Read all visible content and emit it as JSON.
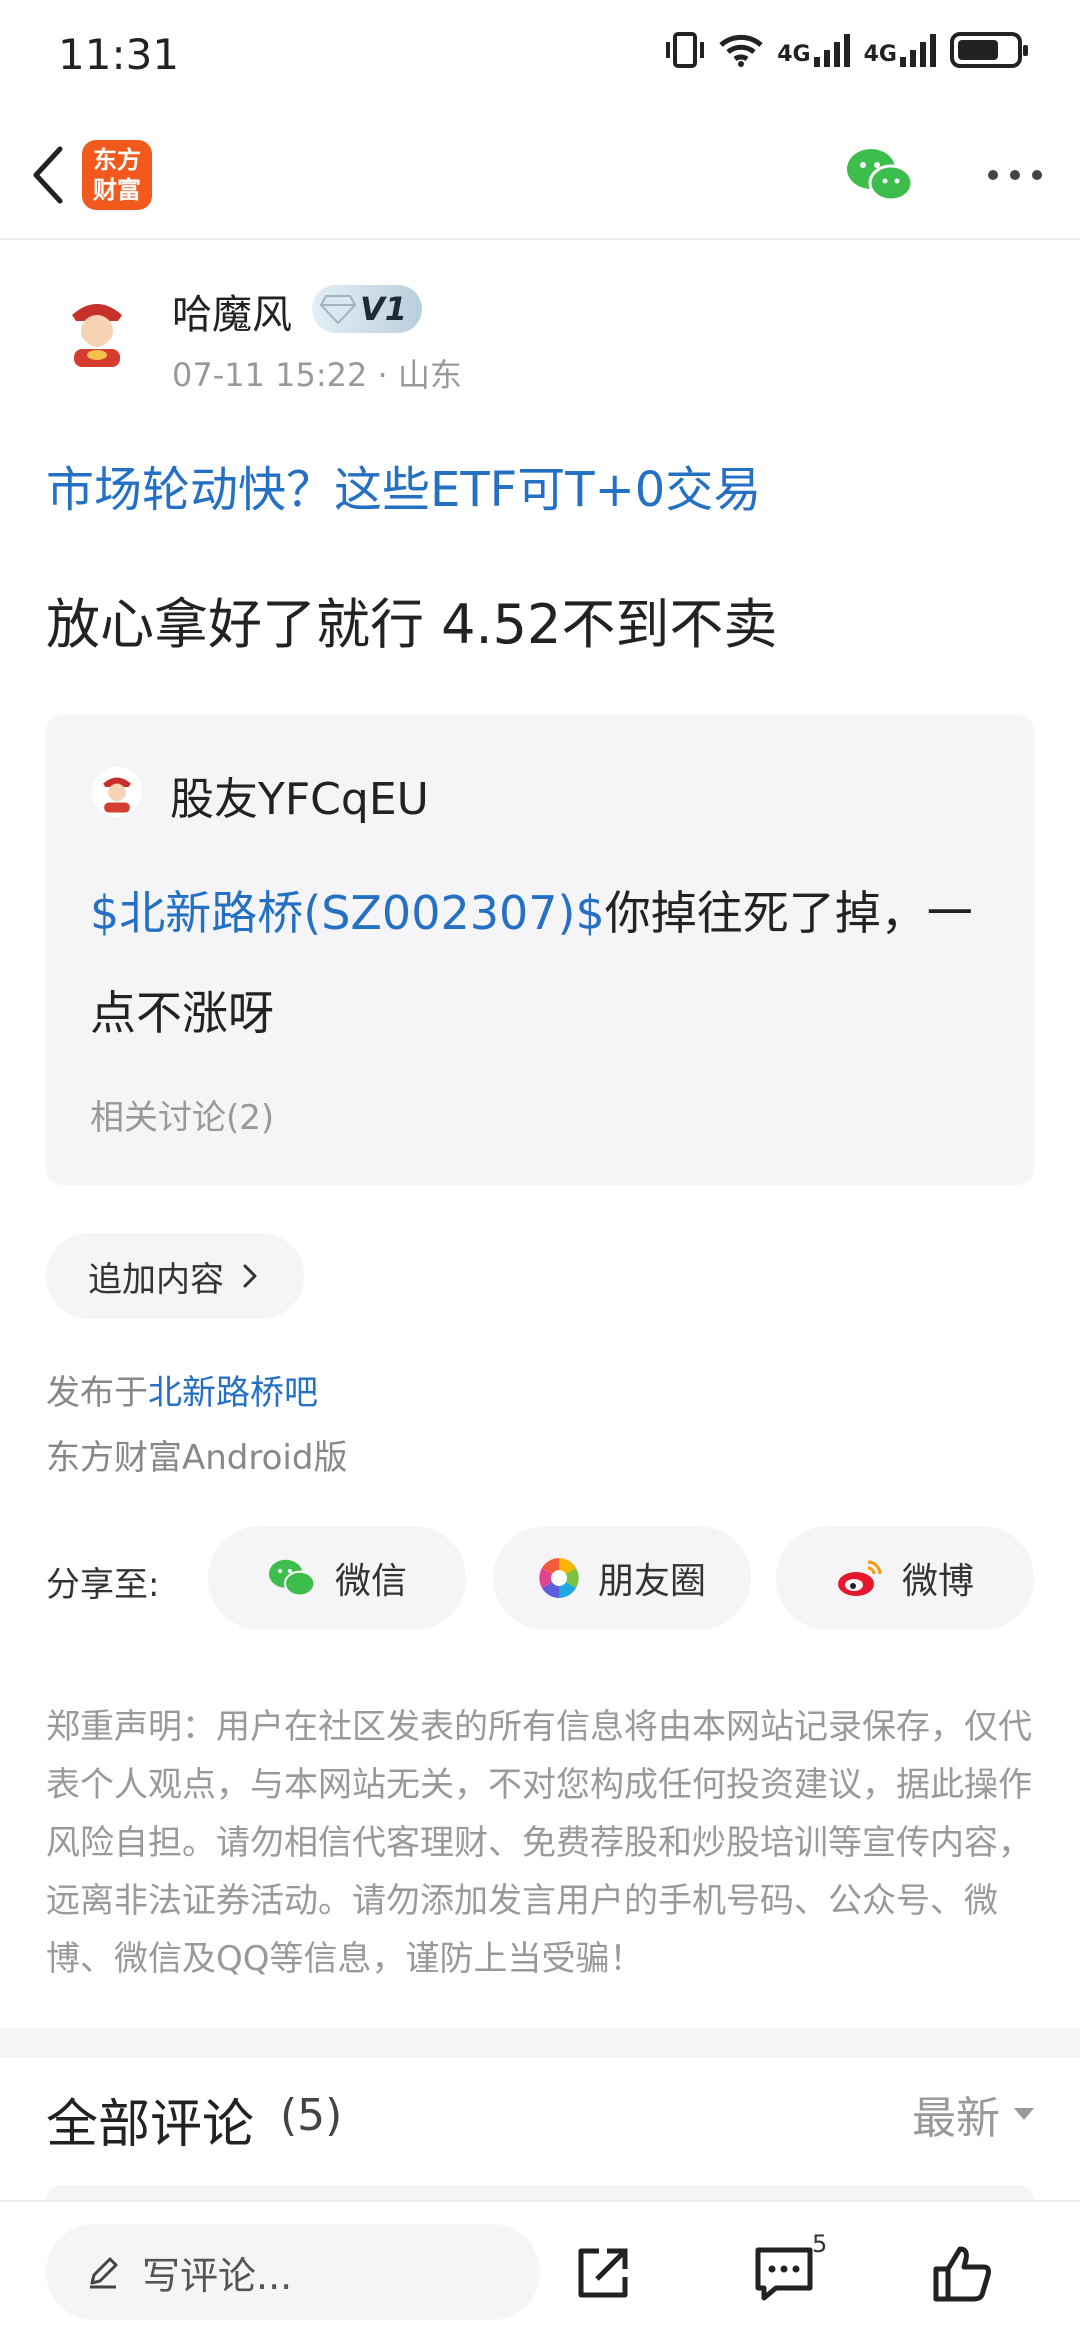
{
  "status_bar": {
    "time": "11:31",
    "net1": "4G",
    "net2": "4G"
  },
  "header": {
    "logo_line1": "东方",
    "logo_line2": "财富"
  },
  "author": {
    "name": "哈魔风",
    "level": "V1",
    "date": "07-11 15:22",
    "location": "山东"
  },
  "article": {
    "title": "市场轮动快？这些ETF可T+0交易",
    "body": "放心拿好了就行 4.52不到不卖"
  },
  "quote": {
    "user": "股友YFCqEU",
    "stock_link": "$北新路桥(SZ002307)$",
    "text": "你掉往死了掉，一点不涨呀",
    "related": "相关讨论(2)"
  },
  "append_label": "追加内容",
  "published": {
    "prefix": "发布于",
    "bar": "北新路桥吧",
    "client": "东方财富Android版"
  },
  "share": {
    "label": "分享至:",
    "wechat": "微信",
    "moments": "朋友圈",
    "weibo": "微博"
  },
  "disclaimer": "郑重声明：用户在社区发表的所有信息将由本网站记录保存，仅代表个人观点，与本网站无关，不对您构成任何投资建议，据此操作风险自担。请勿相信代客理财、免费荐股和炒股培训等宣传内容，远离非法证券活动。请勿添加发言用户的手机号码、公众号、微博、微信及QQ等信息，谨防上当受骗！",
  "comments": {
    "title": "全部评论",
    "count": "(5)",
    "sort": "最新"
  },
  "bottom_bar": {
    "placeholder": "写评论...",
    "message_count": "5"
  },
  "colors": {
    "link": "#2470c4",
    "brand": "#f25a1d",
    "wechat": "#3dbe4c",
    "weibo": "#e6162d"
  }
}
